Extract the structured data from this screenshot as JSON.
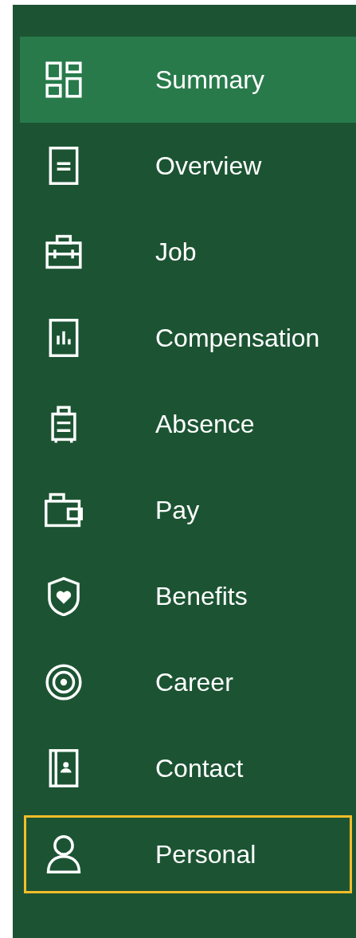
{
  "nav": {
    "items": [
      {
        "label": "Summary",
        "selected": true,
        "focused": false
      },
      {
        "label": "Overview",
        "selected": false,
        "focused": false
      },
      {
        "label": "Job",
        "selected": false,
        "focused": false
      },
      {
        "label": "Compensation",
        "selected": false,
        "focused": false
      },
      {
        "label": "Absence",
        "selected": false,
        "focused": false
      },
      {
        "label": "Pay",
        "selected": false,
        "focused": false
      },
      {
        "label": "Benefits",
        "selected": false,
        "focused": false
      },
      {
        "label": "Career",
        "selected": false,
        "focused": false
      },
      {
        "label": "Contact",
        "selected": false,
        "focused": false
      },
      {
        "label": "Personal",
        "selected": false,
        "focused": true
      }
    ]
  }
}
